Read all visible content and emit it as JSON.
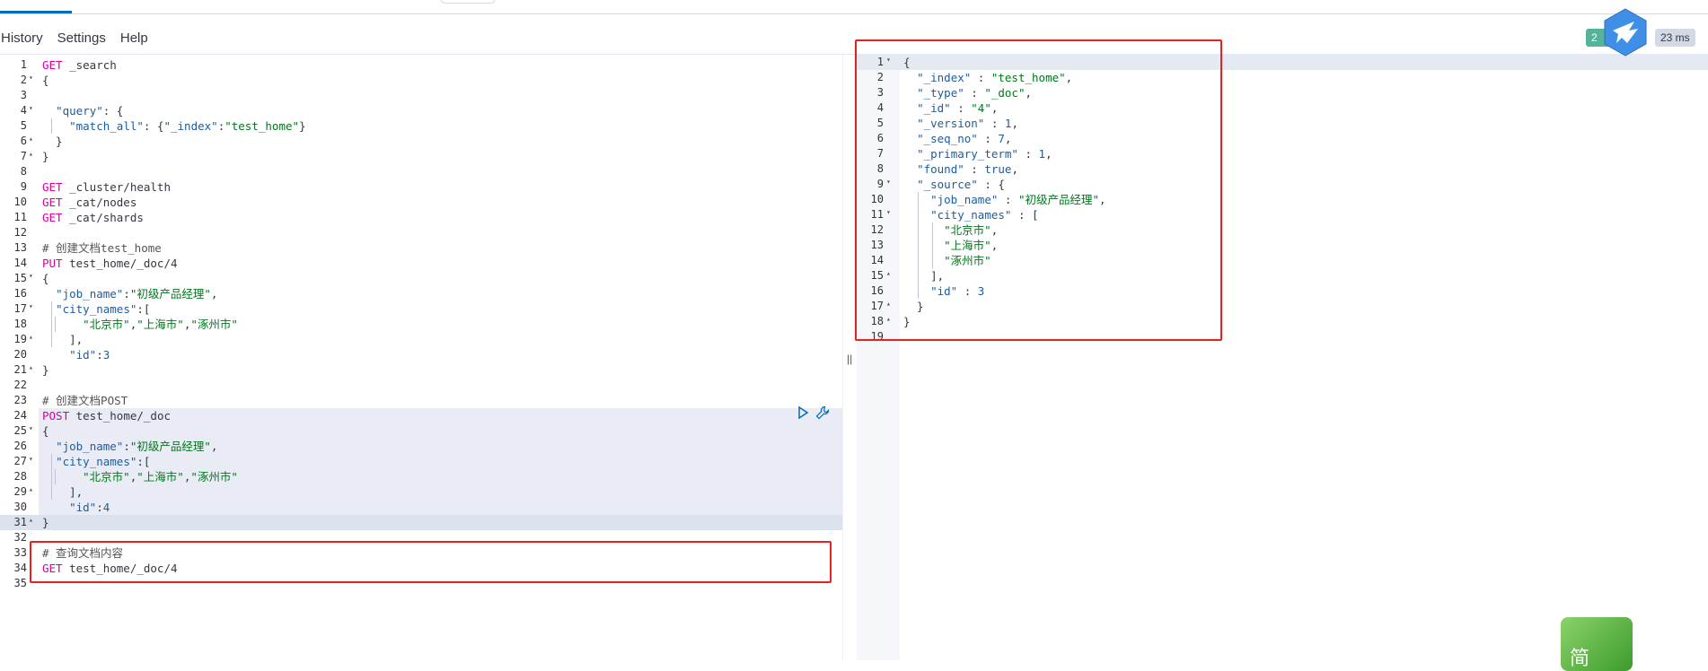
{
  "menu": {
    "history": "History",
    "settings": "Settings",
    "help": "Help"
  },
  "status": {
    "code_partial": "2",
    "time": "23 ms"
  },
  "editor_lines": [
    {
      "n": "1",
      "fold": "",
      "segs": [
        [
          "kw",
          "GET"
        ],
        [
          "path",
          " _search"
        ]
      ]
    },
    {
      "n": "2",
      "fold": "▾",
      "segs": [
        [
          "punc",
          "{"
        ]
      ]
    },
    {
      "n": "3",
      "fold": "",
      "segs": []
    },
    {
      "n": "4",
      "fold": "▾",
      "segs": [
        [
          "punc",
          "  "
        ],
        [
          "key",
          "\"query\""
        ],
        [
          "punc",
          ": {"
        ]
      ]
    },
    {
      "n": "5",
      "fold": "",
      "segs": [
        [
          "punc",
          "    "
        ],
        [
          "key",
          "\"match_all\""
        ],
        [
          "punc",
          ": {"
        ],
        [
          "key",
          "\"_index\""
        ],
        [
          "punc",
          ":"
        ],
        [
          "str",
          "\"test_home\""
        ],
        [
          "punc",
          "}"
        ]
      ]
    },
    {
      "n": "6",
      "fold": "▴",
      "segs": [
        [
          "punc",
          "  }"
        ]
      ]
    },
    {
      "n": "7",
      "fold": "▴",
      "segs": [
        [
          "punc",
          "}"
        ]
      ]
    },
    {
      "n": "8",
      "fold": "",
      "segs": []
    },
    {
      "n": "9",
      "fold": "",
      "segs": [
        [
          "kw",
          "GET"
        ],
        [
          "path",
          " _cluster/health"
        ]
      ]
    },
    {
      "n": "10",
      "fold": "",
      "segs": [
        [
          "kw",
          "GET"
        ],
        [
          "path",
          " _cat/nodes"
        ]
      ]
    },
    {
      "n": "11",
      "fold": "",
      "segs": [
        [
          "kw",
          "GET"
        ],
        [
          "path",
          " _cat/shards"
        ]
      ]
    },
    {
      "n": "12",
      "fold": "",
      "segs": []
    },
    {
      "n": "13",
      "fold": "",
      "segs": [
        [
          "cmt",
          "# 创建文档test_home"
        ]
      ]
    },
    {
      "n": "14",
      "fold": "",
      "segs": [
        [
          "kw",
          "PUT"
        ],
        [
          "path",
          " test_home/_doc/4"
        ]
      ]
    },
    {
      "n": "15",
      "fold": "▾",
      "segs": [
        [
          "punc",
          "{"
        ]
      ]
    },
    {
      "n": "16",
      "fold": "",
      "segs": [
        [
          "punc",
          "  "
        ],
        [
          "key",
          "\"job_name\""
        ],
        [
          "punc",
          ":"
        ],
        [
          "str",
          "\"初级产品经理\""
        ],
        [
          "punc",
          ","
        ]
      ]
    },
    {
      "n": "17",
      "fold": "▾",
      "segs": [
        [
          "punc",
          "  "
        ],
        [
          "key",
          "\"city_names\""
        ],
        [
          "punc",
          ":["
        ]
      ]
    },
    {
      "n": "18",
      "fold": "",
      "segs": [
        [
          "punc",
          "      "
        ],
        [
          "str",
          "\"北京市\""
        ],
        [
          "punc",
          ","
        ],
        [
          "str",
          "\"上海市\""
        ],
        [
          "punc",
          ","
        ],
        [
          "str",
          "\"涿州市\""
        ]
      ]
    },
    {
      "n": "19",
      "fold": "▴",
      "segs": [
        [
          "punc",
          "    ],"
        ]
      ]
    },
    {
      "n": "20",
      "fold": "",
      "segs": [
        [
          "punc",
          "    "
        ],
        [
          "key",
          "\"id\""
        ],
        [
          "punc",
          ":"
        ],
        [
          "num",
          "3"
        ]
      ]
    },
    {
      "n": "21",
      "fold": "▴",
      "segs": [
        [
          "punc",
          "}"
        ]
      ]
    },
    {
      "n": "22",
      "fold": "",
      "segs": []
    },
    {
      "n": "23",
      "fold": "",
      "segs": [
        [
          "cmt",
          "# 创建文档POST"
        ]
      ]
    },
    {
      "n": "24",
      "fold": "",
      "segs": [
        [
          "kw",
          "POST"
        ],
        [
          "path",
          " test_home/_doc"
        ]
      ]
    },
    {
      "n": "25",
      "fold": "▾",
      "segs": [
        [
          "punc",
          "{"
        ]
      ]
    },
    {
      "n": "26",
      "fold": "",
      "segs": [
        [
          "punc",
          "  "
        ],
        [
          "key",
          "\"job_name\""
        ],
        [
          "punc",
          ":"
        ],
        [
          "str",
          "\"初级产品经理\""
        ],
        [
          "punc",
          ","
        ]
      ]
    },
    {
      "n": "27",
      "fold": "▾",
      "segs": [
        [
          "punc",
          "  "
        ],
        [
          "key",
          "\"city_names\""
        ],
        [
          "punc",
          ":["
        ]
      ]
    },
    {
      "n": "28",
      "fold": "",
      "segs": [
        [
          "punc",
          "      "
        ],
        [
          "str",
          "\"北京市\""
        ],
        [
          "punc",
          ","
        ],
        [
          "str",
          "\"上海市\""
        ],
        [
          "punc",
          ","
        ],
        [
          "str",
          "\"涿州市\""
        ]
      ]
    },
    {
      "n": "29",
      "fold": "▴",
      "segs": [
        [
          "punc",
          "    ],"
        ]
      ]
    },
    {
      "n": "30",
      "fold": "",
      "segs": [
        [
          "punc",
          "    "
        ],
        [
          "key",
          "\"id\""
        ],
        [
          "punc",
          ":"
        ],
        [
          "num",
          "4"
        ]
      ]
    },
    {
      "n": "31",
      "fold": "▴",
      "segs": [
        [
          "punc",
          "}"
        ]
      ]
    },
    {
      "n": "32",
      "fold": "",
      "segs": []
    },
    {
      "n": "33",
      "fold": "",
      "segs": [
        [
          "cmt",
          "# 查询文档内容"
        ]
      ]
    },
    {
      "n": "34",
      "fold": "",
      "segs": [
        [
          "kw",
          "GET"
        ],
        [
          "path",
          " test_home/_doc/4"
        ]
      ]
    },
    {
      "n": "35",
      "fold": "",
      "segs": []
    }
  ],
  "output_lines": [
    {
      "n": "1",
      "fold": "▾",
      "segs": [
        [
          "punc",
          "{"
        ]
      ]
    },
    {
      "n": "2",
      "fold": "",
      "segs": [
        [
          "punc",
          "  "
        ],
        [
          "key",
          "\"_index\""
        ],
        [
          "punc",
          " : "
        ],
        [
          "str",
          "\"test_home\""
        ],
        [
          "punc",
          ","
        ]
      ]
    },
    {
      "n": "3",
      "fold": "",
      "segs": [
        [
          "punc",
          "  "
        ],
        [
          "key",
          "\"_type\""
        ],
        [
          "punc",
          " : "
        ],
        [
          "str",
          "\"_doc\""
        ],
        [
          "punc",
          ","
        ]
      ]
    },
    {
      "n": "4",
      "fold": "",
      "segs": [
        [
          "punc",
          "  "
        ],
        [
          "key",
          "\"_id\""
        ],
        [
          "punc",
          " : "
        ],
        [
          "str",
          "\"4\""
        ],
        [
          "punc",
          ","
        ]
      ]
    },
    {
      "n": "5",
      "fold": "",
      "segs": [
        [
          "punc",
          "  "
        ],
        [
          "key",
          "\"_version\""
        ],
        [
          "punc",
          " : "
        ],
        [
          "num",
          "1"
        ],
        [
          "punc",
          ","
        ]
      ]
    },
    {
      "n": "6",
      "fold": "",
      "segs": [
        [
          "punc",
          "  "
        ],
        [
          "key",
          "\"_seq_no\""
        ],
        [
          "punc",
          " : "
        ],
        [
          "num",
          "7"
        ],
        [
          "punc",
          ","
        ]
      ]
    },
    {
      "n": "7",
      "fold": "",
      "segs": [
        [
          "punc",
          "  "
        ],
        [
          "key",
          "\"_primary_term\""
        ],
        [
          "punc",
          " : "
        ],
        [
          "num",
          "1"
        ],
        [
          "punc",
          ","
        ]
      ]
    },
    {
      "n": "8",
      "fold": "",
      "segs": [
        [
          "punc",
          "  "
        ],
        [
          "key",
          "\"found\""
        ],
        [
          "punc",
          " : "
        ],
        [
          "num",
          "true"
        ],
        [
          "punc",
          ","
        ]
      ]
    },
    {
      "n": "9",
      "fold": "▾",
      "segs": [
        [
          "punc",
          "  "
        ],
        [
          "key",
          "\"_source\""
        ],
        [
          "punc",
          " : {"
        ]
      ]
    },
    {
      "n": "10",
      "fold": "",
      "segs": [
        [
          "punc",
          "    "
        ],
        [
          "key",
          "\"job_name\""
        ],
        [
          "punc",
          " : "
        ],
        [
          "str",
          "\"初级产品经理\""
        ],
        [
          "punc",
          ","
        ]
      ]
    },
    {
      "n": "11",
      "fold": "▾",
      "segs": [
        [
          "punc",
          "    "
        ],
        [
          "key",
          "\"city_names\""
        ],
        [
          "punc",
          " : ["
        ]
      ]
    },
    {
      "n": "12",
      "fold": "",
      "segs": [
        [
          "punc",
          "      "
        ],
        [
          "str",
          "\"北京市\""
        ],
        [
          "punc",
          ","
        ]
      ]
    },
    {
      "n": "13",
      "fold": "",
      "segs": [
        [
          "punc",
          "      "
        ],
        [
          "str",
          "\"上海市\""
        ],
        [
          "punc",
          ","
        ]
      ]
    },
    {
      "n": "14",
      "fold": "",
      "segs": [
        [
          "punc",
          "      "
        ],
        [
          "str",
          "\"涿州市\""
        ]
      ]
    },
    {
      "n": "15",
      "fold": "▴",
      "segs": [
        [
          "punc",
          "    ],"
        ]
      ]
    },
    {
      "n": "16",
      "fold": "",
      "segs": [
        [
          "punc",
          "    "
        ],
        [
          "key",
          "\"id\""
        ],
        [
          "punc",
          " : "
        ],
        [
          "num",
          "3"
        ]
      ]
    },
    {
      "n": "17",
      "fold": "▴",
      "segs": [
        [
          "punc",
          "  }"
        ]
      ]
    },
    {
      "n": "18",
      "fold": "▴",
      "segs": [
        [
          "punc",
          "}"
        ]
      ]
    },
    {
      "n": "19",
      "fold": "",
      "segs": []
    }
  ],
  "widget": {
    "glyph": "简"
  },
  "icons": {
    "run": "play-icon",
    "settings": "wrench-icon",
    "grip": "drag-handle-icon",
    "bird": "bird-logo-icon"
  }
}
